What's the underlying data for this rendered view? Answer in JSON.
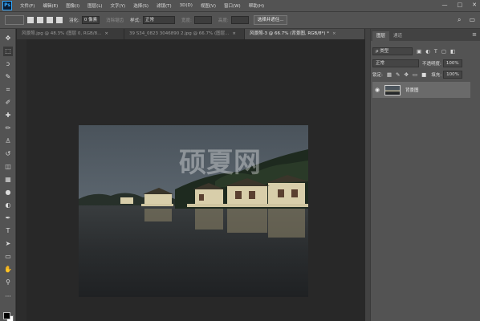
{
  "app": {
    "logo_text": "Ps"
  },
  "menu": [
    "文件(F)",
    "编辑(E)",
    "图像(I)",
    "图层(L)",
    "文字(Y)",
    "选择(S)",
    "滤镜(T)",
    "3D(D)",
    "视图(V)",
    "窗口(W)",
    "帮助(H)"
  ],
  "window_controls": {
    "minimize": "—",
    "maximize": "□",
    "close": "✕"
  },
  "options": {
    "feather_label": "羽化:",
    "feather_value": "0 像素",
    "antialias_label": "消除锯齿",
    "style_label": "样式:",
    "style_value": "正常",
    "width_label": "宽度:",
    "height_label": "高度:",
    "select_mask_button": "选择并遮住...",
    "search_glyph": "⌕",
    "workspace_glyph": "▭"
  },
  "tabs": [
    {
      "title": "风景照.jpg @ 48.3% (图层 0, RGB/8...",
      "close": "×"
    },
    {
      "title": "39 S34_0823 3046890 2.jpg @ 66.7% (图层...",
      "close": "×"
    },
    {
      "title": "风景照-3 @ 66.7% (背景图, RGB/8*) *",
      "close": "×"
    }
  ],
  "tools": [
    {
      "name": "move-tool",
      "glyph": "✥"
    },
    {
      "name": "marquee-tool",
      "glyph": "⬚"
    },
    {
      "name": "lasso-tool",
      "glyph": "ↄ"
    },
    {
      "name": "quick-select-tool",
      "glyph": "✎"
    },
    {
      "name": "crop-tool",
      "glyph": "⌗"
    },
    {
      "name": "eyedropper-tool",
      "glyph": "✐"
    },
    {
      "name": "healing-brush-tool",
      "glyph": "✚"
    },
    {
      "name": "brush-tool",
      "glyph": "✏"
    },
    {
      "name": "clone-stamp-tool",
      "glyph": "♙"
    },
    {
      "name": "history-brush-tool",
      "glyph": "↺"
    },
    {
      "name": "eraser-tool",
      "glyph": "◫"
    },
    {
      "name": "gradient-tool",
      "glyph": "▦"
    },
    {
      "name": "blur-tool",
      "glyph": "●"
    },
    {
      "name": "dodge-tool",
      "glyph": "◐"
    },
    {
      "name": "pen-tool",
      "glyph": "✒"
    },
    {
      "name": "type-tool",
      "glyph": "T"
    },
    {
      "name": "path-select-tool",
      "glyph": "➤"
    },
    {
      "name": "rectangle-tool",
      "glyph": "▭"
    },
    {
      "name": "hand-tool",
      "glyph": "✋"
    },
    {
      "name": "zoom-tool",
      "glyph": "⚲"
    },
    {
      "name": "more-tools",
      "glyph": "···"
    }
  ],
  "panel": {
    "tabs": [
      "图层",
      "通道"
    ],
    "menu_glyph": "≡",
    "kind_filter": "ρ 类型",
    "blend_mode": "正常",
    "opacity_label": "不透明度:",
    "opacity_value": "100%",
    "lock_label": "锁定:",
    "fill_label": "填充:",
    "fill_value": "100%",
    "layer": {
      "name": "背景图",
      "visible_glyph": "◉",
      "lock_glyph": "🔒"
    }
  },
  "watermark": "硕夏网",
  "colors": {
    "ui_gray": "#535353",
    "canvas_bg": "#282828",
    "layer_selected": "#6a6a6a",
    "foreground_swatch": "#000000",
    "background_swatch": "#ffffff"
  }
}
